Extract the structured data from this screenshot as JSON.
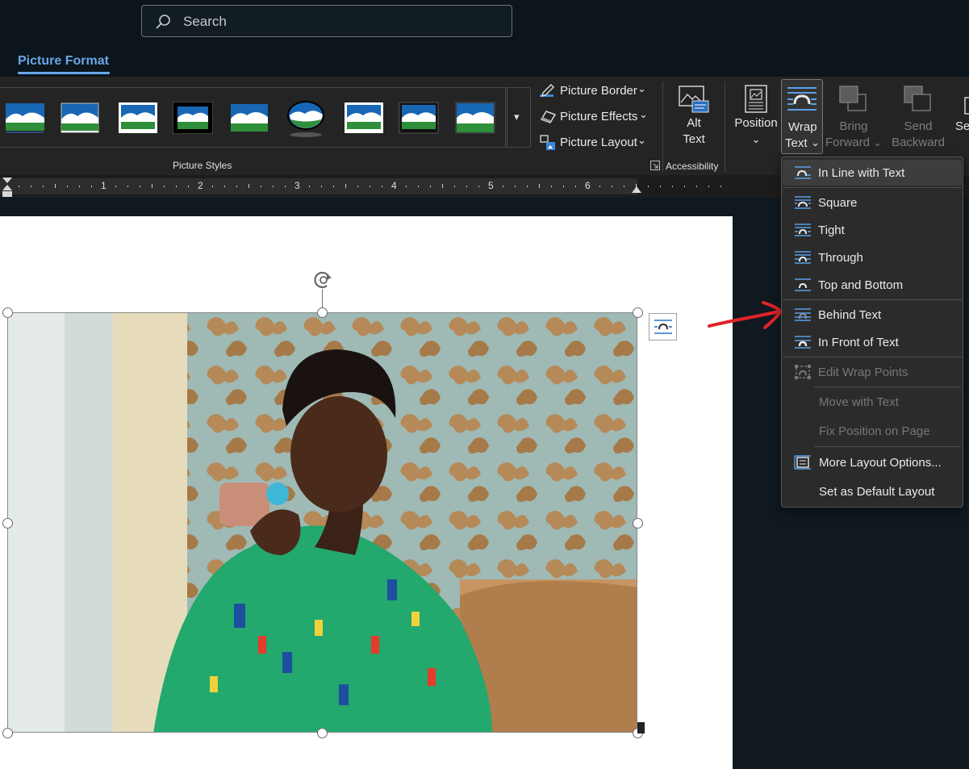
{
  "search": {
    "placeholder": "Search"
  },
  "tabs": {
    "active": "Picture Format"
  },
  "ribbon": {
    "picture_styles_group": "Picture Styles",
    "picture_border": "Picture Border",
    "picture_effects": "Picture Effects",
    "picture_layout": "Picture Layout",
    "alt_text_line1": "Alt",
    "alt_text_line2": "Text",
    "accessibility_group": "Accessibility",
    "position": "Position",
    "wrap_line1": "Wrap",
    "wrap_line2": "Text",
    "bring_line1": "Bring",
    "bring_line2": "Forward",
    "send_line1": "Send",
    "send_line2": "Backward",
    "select_partial": "Se",
    "dropdown_glyph": "⌄"
  },
  "ruler": {
    "numbers": [
      "1",
      "2",
      "3",
      "4",
      "5",
      "6"
    ]
  },
  "wrap_menu": {
    "items": [
      {
        "label": "In Line with Text",
        "state": "selected"
      },
      {
        "label": "Square",
        "state": "enabled"
      },
      {
        "label": "Tight",
        "state": "enabled"
      },
      {
        "label": "Through",
        "state": "enabled"
      },
      {
        "label": "Top and Bottom",
        "state": "enabled"
      },
      {
        "label": "Behind Text",
        "state": "enabled"
      },
      {
        "label": "In Front of Text",
        "state": "enabled"
      },
      {
        "label": "Edit Wrap Points",
        "state": "disabled"
      },
      {
        "label": "Move with Text",
        "state": "disabled"
      },
      {
        "label": "Fix Position on Page",
        "state": "disabled"
      },
      {
        "label": "More Layout Options...",
        "state": "enabled"
      },
      {
        "label": "Set as Default Layout",
        "state": "enabled"
      }
    ]
  },
  "colors": {
    "accent": "#6aa6e8",
    "annotation_arrow": "#e0242a"
  }
}
